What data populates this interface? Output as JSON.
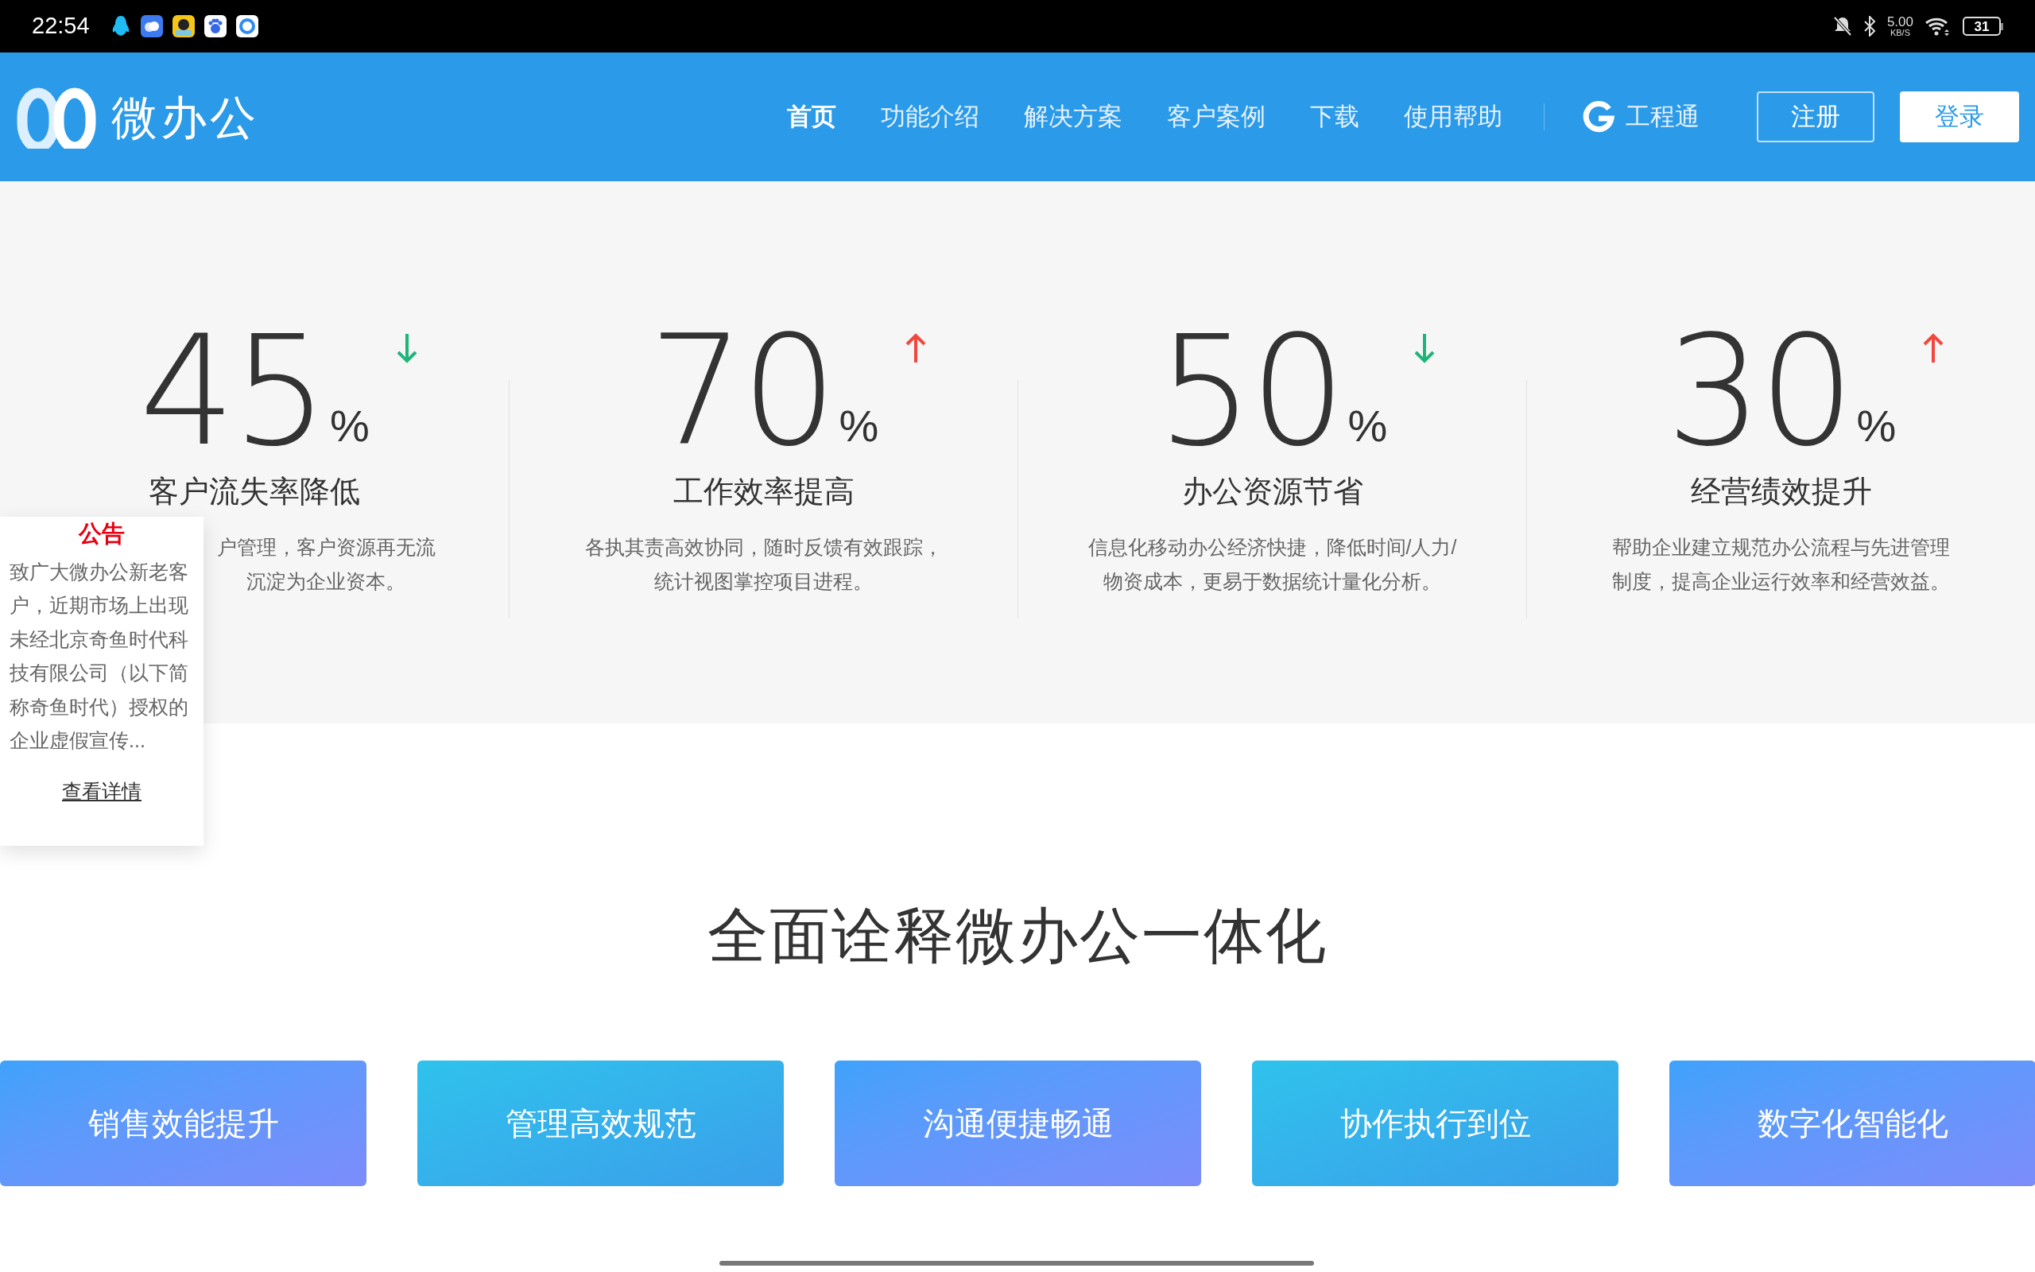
{
  "status_bar": {
    "time": "22:54",
    "speed_value": "5.00",
    "speed_unit": "KB/S",
    "battery": "31"
  },
  "header": {
    "logo_text": "微办公",
    "nav": [
      {
        "label": "首页",
        "selected": true
      },
      {
        "label": "功能介绍",
        "selected": false
      },
      {
        "label": "解决方案",
        "selected": false
      },
      {
        "label": "客户案例",
        "selected": false
      },
      {
        "label": "下载",
        "selected": false
      },
      {
        "label": "使用帮助",
        "selected": false
      }
    ],
    "partner_link": "工程通",
    "register_button": "注册",
    "login_button": "登录"
  },
  "stats": [
    {
      "number": "45",
      "unit": "%",
      "rising": false,
      "title": "客户流失率降低",
      "lines": [
        "户管理，客户资源再无流",
        "沉淀为企业资本。"
      ]
    },
    {
      "number": "70",
      "unit": "%",
      "rising": true,
      "title": "工作效率提高",
      "lines": [
        "各执其责高效协同，随时反馈有效跟踪，",
        "统计视图掌控项目进程。"
      ]
    },
    {
      "number": "50",
      "unit": "%",
      "rising": false,
      "title": "办公资源节省",
      "lines": [
        "信息化移动办公经济快捷，降低时间/人力/",
        "物资成本，更易于数据统计量化分析。"
      ]
    },
    {
      "number": "30",
      "unit": "%",
      "rising": true,
      "title": "经营绩效提升",
      "lines": [
        "帮助企业建立规范办公流程与先进管理",
        "制度，提高企业运行效率和经营效益。"
      ]
    }
  ],
  "notice": {
    "title": "公告",
    "body": "致广大微办公新老客户，近期市场上出现未经北京奇鱼时代科技有限公司（以下简称奇鱼时代）授权的企业虚假宣传...",
    "link": "查看详情"
  },
  "section_heading": "全面诠释微办公一体化",
  "feature_cards": [
    {
      "label": "销售效能提升",
      "kind": "violet"
    },
    {
      "label": "管理高效规范",
      "kind": "cyan"
    },
    {
      "label": "沟通便捷畅通",
      "kind": "violet"
    },
    {
      "label": "协作执行到位",
      "kind": "cyan"
    },
    {
      "label": "数字化智能化",
      "kind": "violet"
    }
  ]
}
